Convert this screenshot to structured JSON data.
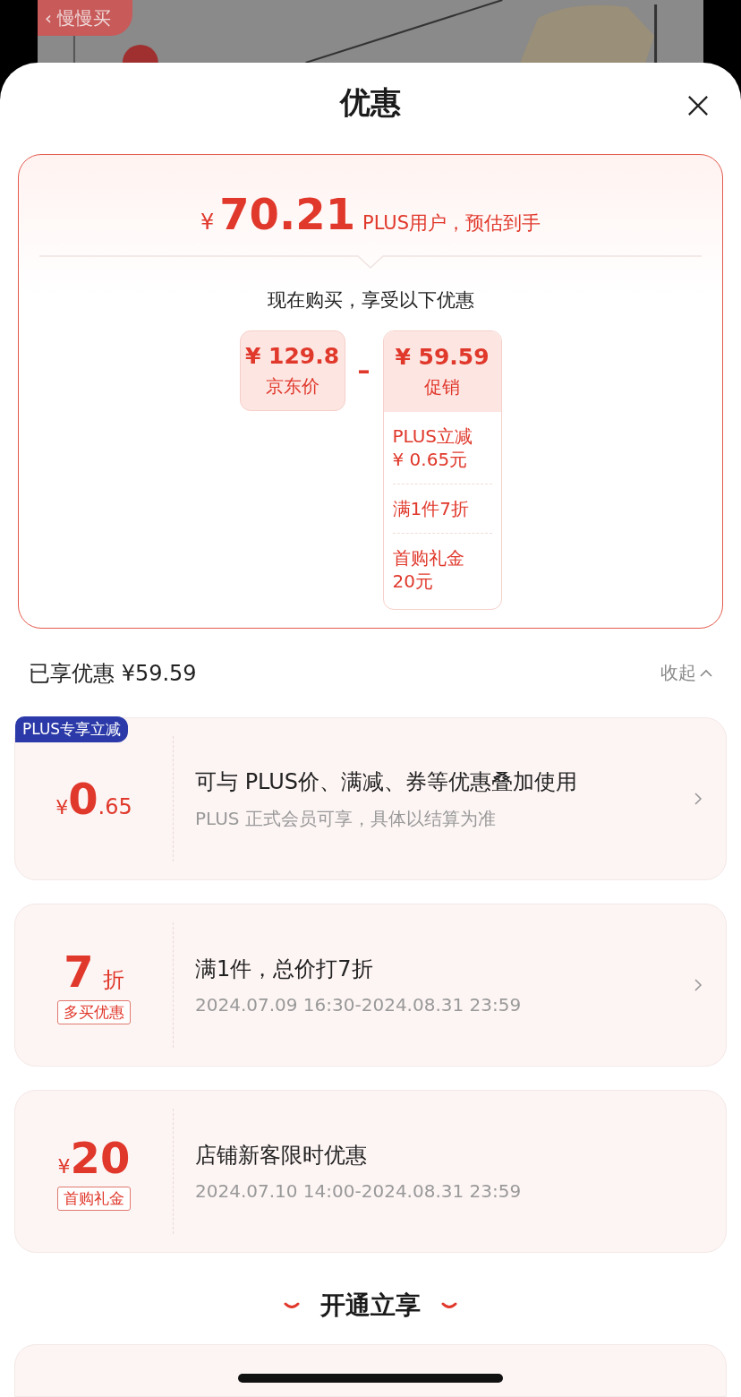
{
  "background": {
    "kind": "picture",
    "back_button": {
      "icon": "‹",
      "label": "慢慢买"
    }
  },
  "sheet": {
    "title": "优惠"
  },
  "summary": {
    "currency": "¥",
    "price": "70.21",
    "caption": "PLUS用户，预估到手",
    "intro": "现在购买，享受以下优惠",
    "base": {
      "amount": "¥ 129.8",
      "label": "京东价"
    },
    "operator": "–",
    "discount": {
      "amount": "¥ 59.59",
      "label": "促销",
      "items": [
        "PLUS立减\n¥ 0.65元",
        "满1件7折",
        "首购礼金\n20元"
      ]
    }
  },
  "enjoyed": {
    "label": "已享优惠 ¥59.59",
    "toggle": "收起",
    "expanded": true
  },
  "coupons": [
    {
      "badge": "PLUS专享立减",
      "prefix": "¥",
      "main": "0",
      "suffix": ".65",
      "title": "可与 PLUS价、满减、券等优惠叠加使用",
      "subtitle": "PLUS 正式会员可享，具体以结算为准",
      "chevron": true
    },
    {
      "main": "7",
      "suffix": "折",
      "tag": "多买优惠",
      "title": "满1件，总价打7折",
      "subtitle": "2024.07.09 16:30-2024.08.31 23:59",
      "chevron": true
    },
    {
      "prefix": "¥",
      "main": "20",
      "tag": "首购礼金",
      "title": "店铺新客限时优惠",
      "subtitle": "2024.07.10 14:00-2024.08.31 23:59",
      "chevron": false
    }
  ],
  "section": {
    "title": "开通立享"
  }
}
